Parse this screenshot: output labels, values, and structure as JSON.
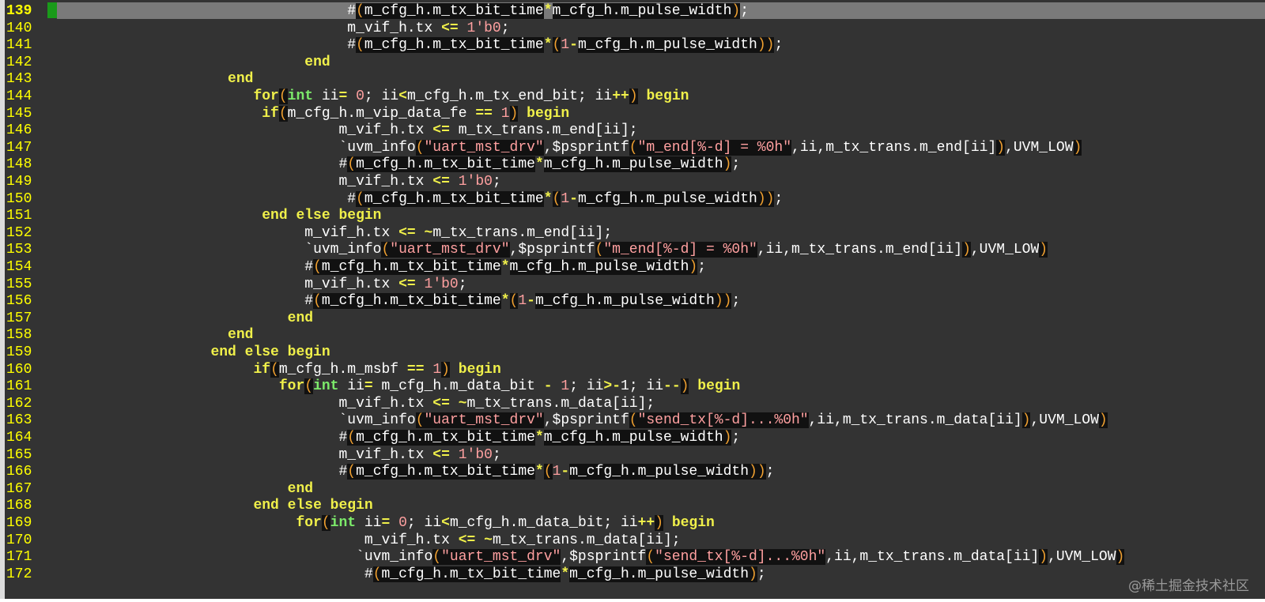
{
  "editor": {
    "current_line": "139",
    "lines": [
      {
        "n": "139",
        "current": true,
        "indent": "                                  ",
        "segs": [
          [
            "p",
            "#"
          ],
          [
            "paren",
            "("
          ],
          [
            "d",
            "m_cfg_h.m_tx_bit_time"
          ],
          [
            "op",
            "*"
          ],
          [
            "d",
            "m_cfg_h.m_pulse_width"
          ],
          [
            "paren",
            ")"
          ],
          [
            "p",
            ";"
          ]
        ]
      },
      {
        "n": "140",
        "indent": "                                  ",
        "segs": [
          [
            "p",
            "m_vif_h.tx "
          ],
          [
            "op",
            "<="
          ],
          [
            "p",
            " "
          ],
          [
            "num",
            "1'b0"
          ],
          [
            "p",
            ";"
          ]
        ]
      },
      {
        "n": "141",
        "indent": "                                  ",
        "segs": [
          [
            "p",
            "#"
          ],
          [
            "paren",
            "("
          ],
          [
            "d",
            "m_cfg_h.m_tx_bit_time"
          ],
          [
            "op",
            "*"
          ],
          [
            "paren",
            "("
          ],
          [
            "num",
            "1"
          ],
          [
            "op",
            "-"
          ],
          [
            "d",
            "m_cfg_h.m_pulse_width"
          ],
          [
            "paren",
            "))"
          ],
          [
            "p",
            ";"
          ]
        ]
      },
      {
        "n": "142",
        "indent": "                             ",
        "segs": [
          [
            "kw",
            "end"
          ]
        ]
      },
      {
        "n": "143",
        "indent": "                    ",
        "segs": [
          [
            "kw",
            "end"
          ]
        ]
      },
      {
        "n": "144",
        "indent": "                       ",
        "segs": [
          [
            "kw",
            "for"
          ],
          [
            "paren",
            "("
          ],
          [
            "type",
            "int"
          ],
          [
            "p",
            " ii"
          ],
          [
            "op",
            "="
          ],
          [
            "p",
            " "
          ],
          [
            "num",
            "0"
          ],
          [
            "p",
            "; ii"
          ],
          [
            "op",
            "<"
          ],
          [
            "p",
            "m_cfg_h.m_tx_end_bit; ii"
          ],
          [
            "op",
            "++"
          ],
          [
            "paren",
            ")"
          ],
          [
            "p",
            " "
          ],
          [
            "kw",
            "begin"
          ]
        ]
      },
      {
        "n": "145",
        "indent": "                        ",
        "segs": [
          [
            "kw",
            "if"
          ],
          [
            "paren",
            "("
          ],
          [
            "p",
            "m_cfg_h.m_vip_data_fe "
          ],
          [
            "op",
            "=="
          ],
          [
            "p",
            " "
          ],
          [
            "num",
            "1"
          ],
          [
            "paren",
            ")"
          ],
          [
            "p",
            " "
          ],
          [
            "kw",
            "begin"
          ]
        ]
      },
      {
        "n": "146",
        "indent": "                                 ",
        "segs": [
          [
            "p",
            "m_vif_h.tx "
          ],
          [
            "op",
            "<="
          ],
          [
            "p",
            " m_tx_trans.m_end[ii];"
          ]
        ]
      },
      {
        "n": "147",
        "indent": "                                 ",
        "segs": [
          [
            "p",
            "`uvm_info"
          ],
          [
            "paren",
            "("
          ],
          [
            "str",
            "\"uart_mst_drv\""
          ],
          [
            "p",
            ",$psprintf"
          ],
          [
            "paren",
            "("
          ],
          [
            "str",
            "\"m_end[%-d] = %0h\""
          ],
          [
            "p",
            ",ii,m_tx_trans.m_end[ii]"
          ],
          [
            "paren",
            ")"
          ],
          [
            "p",
            ",UVM_LOW"
          ],
          [
            "paren",
            ")"
          ]
        ]
      },
      {
        "n": "148",
        "indent": "                                 ",
        "segs": [
          [
            "p",
            "#"
          ],
          [
            "paren",
            "("
          ],
          [
            "d",
            "m_cfg_h.m_tx_bit_time"
          ],
          [
            "op",
            "*"
          ],
          [
            "d",
            "m_cfg_h.m_pulse_width"
          ],
          [
            "paren",
            ")"
          ],
          [
            "p",
            ";"
          ]
        ]
      },
      {
        "n": "149",
        "indent": "                                 ",
        "segs": [
          [
            "p",
            "m_vif_h.tx "
          ],
          [
            "op",
            "<="
          ],
          [
            "p",
            " "
          ],
          [
            "num",
            "1'b0"
          ],
          [
            "p",
            ";"
          ]
        ]
      },
      {
        "n": "150",
        "indent": "                                 ",
        "segs": [
          [
            "p",
            " #"
          ],
          [
            "paren",
            "("
          ],
          [
            "d",
            "m_cfg_h.m_tx_bit_time"
          ],
          [
            "op",
            "*"
          ],
          [
            "paren",
            "("
          ],
          [
            "num",
            "1"
          ],
          [
            "op",
            "-"
          ],
          [
            "d",
            "m_cfg_h.m_pulse_width"
          ],
          [
            "paren",
            "))"
          ],
          [
            "p",
            ";"
          ]
        ]
      },
      {
        "n": "151",
        "indent": "                        ",
        "segs": [
          [
            "kw",
            "end else begin"
          ]
        ]
      },
      {
        "n": "152",
        "indent": "                             ",
        "segs": [
          [
            "p",
            "m_vif_h.tx "
          ],
          [
            "op",
            "<="
          ],
          [
            "p",
            " "
          ],
          [
            "op",
            "~"
          ],
          [
            "p",
            "m_tx_trans.m_end[ii];"
          ]
        ]
      },
      {
        "n": "153",
        "indent": "                             ",
        "segs": [
          [
            "p",
            "`uvm_info"
          ],
          [
            "paren",
            "("
          ],
          [
            "str",
            "\"uart_mst_drv\""
          ],
          [
            "p",
            ",$psprintf"
          ],
          [
            "paren",
            "("
          ],
          [
            "str",
            "\"m_end[%-d] = %0h\""
          ],
          [
            "p",
            ",ii,m_tx_trans.m_end[ii]"
          ],
          [
            "paren",
            ")"
          ],
          [
            "p",
            ",UVM_LOW"
          ],
          [
            "paren",
            ")"
          ]
        ]
      },
      {
        "n": "154",
        "indent": "                             ",
        "segs": [
          [
            "p",
            "#"
          ],
          [
            "paren",
            "("
          ],
          [
            "d",
            "m_cfg_h.m_tx_bit_time"
          ],
          [
            "op",
            "*"
          ],
          [
            "d",
            "m_cfg_h.m_pulse_width"
          ],
          [
            "paren",
            ")"
          ],
          [
            "p",
            ";"
          ]
        ]
      },
      {
        "n": "155",
        "indent": "                             ",
        "segs": [
          [
            "p",
            "m_vif_h.tx "
          ],
          [
            "op",
            "<="
          ],
          [
            "p",
            " "
          ],
          [
            "num",
            "1'b0"
          ],
          [
            "p",
            ";"
          ]
        ]
      },
      {
        "n": "156",
        "indent": "                             ",
        "segs": [
          [
            "p",
            "#"
          ],
          [
            "paren",
            "("
          ],
          [
            "d",
            "m_cfg_h.m_tx_bit_time"
          ],
          [
            "op",
            "*"
          ],
          [
            "paren",
            "("
          ],
          [
            "num",
            "1"
          ],
          [
            "op",
            "-"
          ],
          [
            "d",
            "m_cfg_h.m_pulse_width"
          ],
          [
            "paren",
            "))"
          ],
          [
            "p",
            ";"
          ]
        ]
      },
      {
        "n": "157",
        "indent": "                           ",
        "segs": [
          [
            "kw",
            "end"
          ]
        ]
      },
      {
        "n": "158",
        "indent": "                    ",
        "segs": [
          [
            "kw",
            "end"
          ]
        ]
      },
      {
        "n": "159",
        "indent": "                  ",
        "segs": [
          [
            "kw",
            "end else begin"
          ]
        ]
      },
      {
        "n": "160",
        "indent": "                       ",
        "segs": [
          [
            "kw",
            "if"
          ],
          [
            "paren",
            "("
          ],
          [
            "p",
            "m_cfg_h.m_msbf "
          ],
          [
            "op",
            "=="
          ],
          [
            "p",
            " "
          ],
          [
            "num",
            "1"
          ],
          [
            "paren",
            ")"
          ],
          [
            "p",
            " "
          ],
          [
            "kw",
            "begin"
          ]
        ]
      },
      {
        "n": "161",
        "indent": "                          ",
        "segs": [
          [
            "kw",
            "for"
          ],
          [
            "paren",
            "("
          ],
          [
            "type",
            "int"
          ],
          [
            "p",
            " ii"
          ],
          [
            "op",
            "="
          ],
          [
            "p",
            " m_cfg_h.m_data_bit "
          ],
          [
            "op",
            "-"
          ],
          [
            "p",
            " "
          ],
          [
            "num",
            "1"
          ],
          [
            "p",
            "; ii"
          ],
          [
            "op",
            ">-"
          ],
          [
            "p",
            "1; ii"
          ],
          [
            "op",
            "--"
          ],
          [
            "paren",
            ")"
          ],
          [
            "p",
            " "
          ],
          [
            "kw",
            "begin"
          ]
        ]
      },
      {
        "n": "162",
        "indent": "                                 ",
        "segs": [
          [
            "p",
            "m_vif_h.tx "
          ],
          [
            "op",
            "<="
          ],
          [
            "p",
            " "
          ],
          [
            "op",
            "~"
          ],
          [
            "p",
            "m_tx_trans.m_data[ii];"
          ]
        ]
      },
      {
        "n": "163",
        "indent": "                                 ",
        "segs": [
          [
            "p",
            "`uvm_info"
          ],
          [
            "paren",
            "("
          ],
          [
            "str",
            "\"uart_mst_drv\""
          ],
          [
            "p",
            ",$psprintf"
          ],
          [
            "paren",
            "("
          ],
          [
            "str",
            "\"send_tx[%-d]...%0h\""
          ],
          [
            "p",
            ",ii,m_tx_trans.m_data[ii]"
          ],
          [
            "paren",
            ")"
          ],
          [
            "p",
            ",UVM_LOW"
          ],
          [
            "paren",
            ")"
          ]
        ]
      },
      {
        "n": "164",
        "indent": "                                 ",
        "segs": [
          [
            "p",
            "#"
          ],
          [
            "paren",
            "("
          ],
          [
            "d",
            "m_cfg_h.m_tx_bit_time"
          ],
          [
            "op",
            "*"
          ],
          [
            "d",
            "m_cfg_h.m_pulse_width"
          ],
          [
            "paren",
            ")"
          ],
          [
            "p",
            ";"
          ]
        ]
      },
      {
        "n": "165",
        "indent": "                                 ",
        "segs": [
          [
            "p",
            "m_vif_h.tx "
          ],
          [
            "op",
            "<="
          ],
          [
            "p",
            " "
          ],
          [
            "num",
            "1'b0"
          ],
          [
            "p",
            ";"
          ]
        ]
      },
      {
        "n": "166",
        "indent": "                                 ",
        "segs": [
          [
            "p",
            "#"
          ],
          [
            "paren",
            "("
          ],
          [
            "d",
            "m_cfg_h.m_tx_bit_time"
          ],
          [
            "op",
            "*"
          ],
          [
            "paren",
            "("
          ],
          [
            "num",
            "1"
          ],
          [
            "op",
            "-"
          ],
          [
            "d",
            "m_cfg_h.m_pulse_width"
          ],
          [
            "paren",
            "))"
          ],
          [
            "p",
            ";"
          ]
        ]
      },
      {
        "n": "167",
        "indent": "                           ",
        "segs": [
          [
            "kw",
            "end"
          ]
        ]
      },
      {
        "n": "168",
        "indent": "                       ",
        "segs": [
          [
            "kw",
            "end else begin"
          ]
        ]
      },
      {
        "n": "169",
        "indent": "                            ",
        "segs": [
          [
            "kw",
            "for"
          ],
          [
            "paren",
            "("
          ],
          [
            "type",
            "int"
          ],
          [
            "p",
            " ii"
          ],
          [
            "op",
            "="
          ],
          [
            "p",
            " "
          ],
          [
            "num",
            "0"
          ],
          [
            "p",
            "; ii"
          ],
          [
            "op",
            "<"
          ],
          [
            "p",
            "m_cfg_h.m_data_bit; ii"
          ],
          [
            "op",
            "++"
          ],
          [
            "paren",
            ")"
          ],
          [
            "p",
            " "
          ],
          [
            "kw",
            "begin"
          ]
        ]
      },
      {
        "n": "170",
        "indent": "                                    ",
        "segs": [
          [
            "p",
            "m_vif_h.tx "
          ],
          [
            "op",
            "<="
          ],
          [
            "p",
            " "
          ],
          [
            "op",
            "~"
          ],
          [
            "p",
            "m_tx_trans.m_data[ii];"
          ]
        ]
      },
      {
        "n": "171",
        "indent": "                                   ",
        "segs": [
          [
            "p",
            "`uvm_info"
          ],
          [
            "paren",
            "("
          ],
          [
            "str",
            "\"uart_mst_drv\""
          ],
          [
            "p",
            ",$psprintf"
          ],
          [
            "paren",
            "("
          ],
          [
            "str",
            "\"send_tx[%-d]...%0h\""
          ],
          [
            "p",
            ",ii,m_tx_trans.m_data[ii]"
          ],
          [
            "paren",
            ")"
          ],
          [
            "p",
            ",UVM_LOW"
          ],
          [
            "paren",
            ")"
          ]
        ]
      },
      {
        "n": "172",
        "indent": "                                    ",
        "segs": [
          [
            "p",
            "#"
          ],
          [
            "paren",
            "("
          ],
          [
            "d",
            "m_cfg_h.m_tx_bit_time"
          ],
          [
            "op",
            "*"
          ],
          [
            "d",
            "m_cfg_h.m_pulse_width"
          ],
          [
            "paren",
            ")"
          ],
          [
            "p",
            ";"
          ]
        ]
      }
    ]
  },
  "watermark": "@稀土掘金技术社区",
  "colors": {
    "background": "#333333",
    "line_number": "#ffff00",
    "keyword": "#f0f04a",
    "type": "#7cea6a",
    "number_string": "#ffa0a0",
    "paren": "#f0a030",
    "cursorline": "#7a7a7a",
    "sign_marker": "#1a9a1a"
  }
}
